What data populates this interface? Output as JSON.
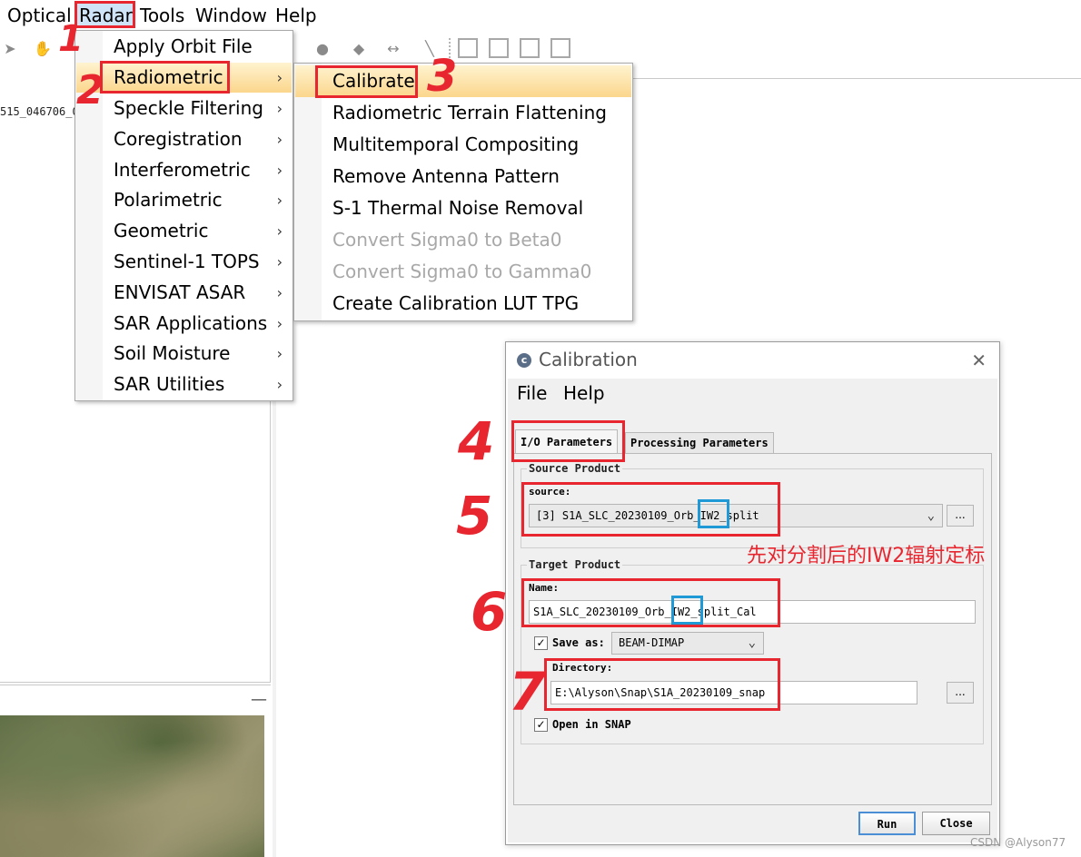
{
  "menubar": {
    "items": [
      "Optical",
      "Radar",
      "Tools",
      "Window",
      "Help"
    ]
  },
  "left_panel": {
    "product_text": "515_046706_0"
  },
  "radar_menu": {
    "items": [
      {
        "label": "Apply Orbit File"
      },
      {
        "label": "Radiometric"
      },
      {
        "label": "Speckle Filtering"
      },
      {
        "label": "Coregistration"
      },
      {
        "label": "Interferometric"
      },
      {
        "label": "Polarimetric"
      },
      {
        "label": "Geometric"
      },
      {
        "label": "Sentinel-1 TOPS"
      },
      {
        "label": "ENVISAT ASAR"
      },
      {
        "label": "SAR Applications"
      },
      {
        "label": "Soil Moisture"
      },
      {
        "label": "SAR Utilities"
      }
    ],
    "submenu_arrow": "›"
  },
  "radiometric_menu": {
    "items": [
      {
        "label": "Calibrate",
        "enabled": true
      },
      {
        "label": "Radiometric Terrain Flattening",
        "enabled": true
      },
      {
        "label": "Multitemporal Compositing",
        "enabled": true
      },
      {
        "label": "Remove Antenna Pattern",
        "enabled": true
      },
      {
        "label": "S-1 Thermal Noise Removal",
        "enabled": true
      },
      {
        "label": "Convert Sigma0 to Beta0",
        "enabled": false
      },
      {
        "label": "Convert Sigma0 to Gamma0",
        "enabled": false
      },
      {
        "label": "Create Calibration LUT TPG",
        "enabled": true
      }
    ]
  },
  "dialog": {
    "title": "Calibration",
    "close_glyph": "✕",
    "logo_glyph": "c",
    "menu": [
      "File",
      "Help"
    ],
    "tabs": [
      "I/O Parameters",
      "Processing Parameters"
    ],
    "source_group": "Source Product",
    "source_label": "source:",
    "source_value": "[3] S1A_SLC_20230109_Orb_IW2_split",
    "target_group": "Target Product",
    "name_label": "Name:",
    "name_value": "S1A_SLC_20230109_Orb_IW2_split_Cal",
    "save_as_label": "Save as:",
    "save_as_value": "BEAM-DIMAP",
    "directory_label": "Directory:",
    "directory_value": "E:\\Alyson\\Snap\\S1A_20230109_snap",
    "open_in_snap_label": "Open in SNAP",
    "browse_label": "...",
    "run_label": "Run",
    "close_label": "Close",
    "chevron": "⌄",
    "check": "✓"
  },
  "annotations": {
    "numbers": [
      "1",
      "2",
      "3",
      "4",
      "5",
      "6",
      "7"
    ],
    "note": "先对分割后的IW2辐射定标",
    "red": "#e8262f",
    "blue": "#1f9ad6"
  },
  "watermark": "CSDN @Alyson77",
  "colors": {
    "menu_selection": "#fbd68c",
    "menubar_selected": "#cfe4f7"
  }
}
